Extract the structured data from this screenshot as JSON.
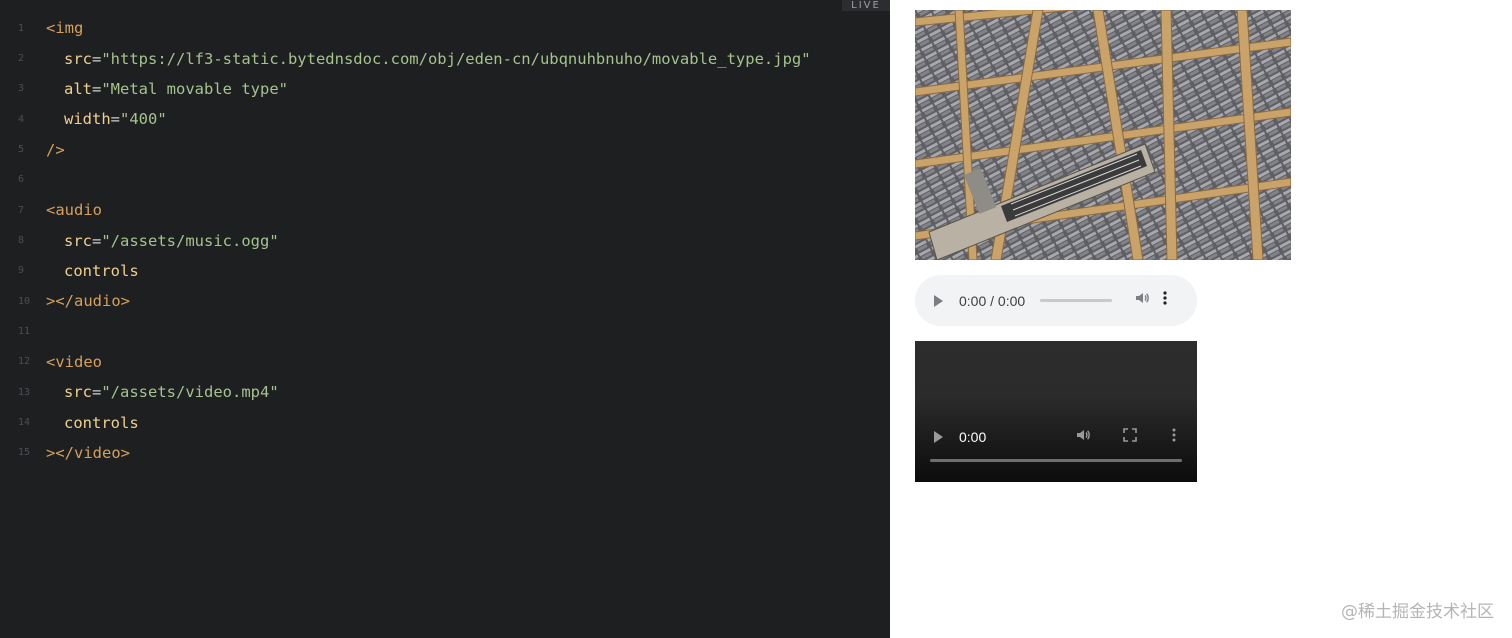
{
  "editor": {
    "badge": "LIVE",
    "line_numbers": [
      "1",
      "2",
      "3",
      "4",
      "5",
      "6",
      "7",
      "8",
      "9",
      "10",
      "11",
      "12",
      "13",
      "14",
      "15"
    ],
    "img": {
      "open": "<img",
      "src_attr": "src",
      "src_val": "\"https://lf3-static.bytednsdoc.com/obj/eden-cn/ubqnuhbnuho/movable_type.jpg\"",
      "alt_attr": "alt",
      "alt_val": "\"Metal movable type\"",
      "width_attr": "width",
      "width_val": "\"400\"",
      "close": "/>"
    },
    "audio": {
      "open": "<audio",
      "src_attr": "src",
      "src_val": "\"/assets/music.ogg\"",
      "controls": "controls",
      "close": "></audio>"
    },
    "video": {
      "open": "<video",
      "src_attr": "src",
      "src_val": "\"/assets/video.mp4\"",
      "controls": "controls",
      "close": "></video>"
    },
    "equals": "="
  },
  "preview": {
    "audio_player": {
      "time": "0:00 / 0:00"
    },
    "video_player": {
      "time": "0:00"
    }
  },
  "icons": {
    "play": "play-icon",
    "volume": "volume-icon",
    "fullscreen": "fullscreen-icon",
    "more": "more-vertical-icon"
  },
  "watermark": "@稀土掘金技术社区"
}
